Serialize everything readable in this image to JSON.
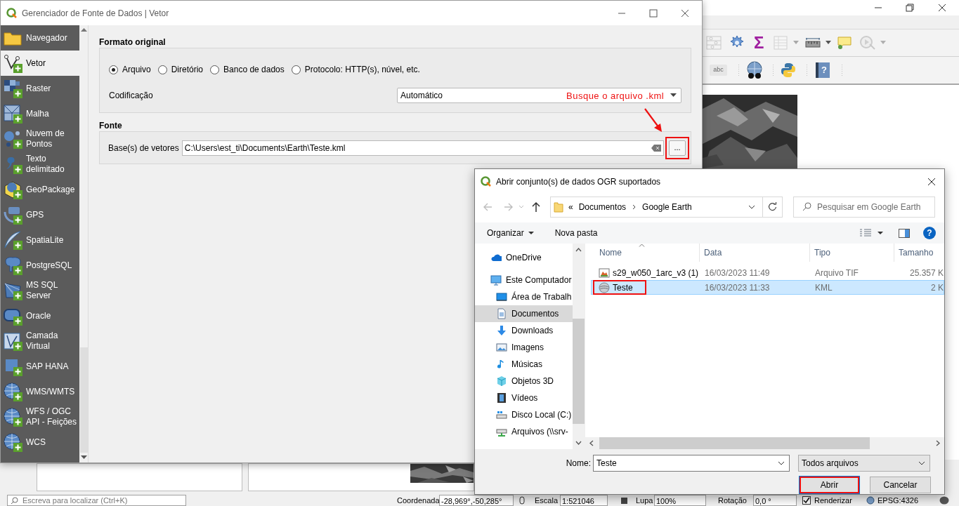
{
  "qgis": {
    "toolbar_glyphs": {
      "sum": "Σ",
      "label": "abc",
      "help": "?"
    },
    "status_bar": {
      "search_placeholder": "Escreva para localizar (Ctrl+K)",
      "coordinate_label": "Coordenada",
      "coordinate": "-28,969°,-50,285°",
      "scale_label": "Escala",
      "scale": "1:521046",
      "magnifier_label": "Lupa",
      "magnifier": "100%",
      "rotation_label": "Rotação",
      "rotation": "0,0 °",
      "render_label": "Renderizar",
      "render_checked": true,
      "crs": "EPSG:4326"
    }
  },
  "data_source_manager": {
    "title": "Gerenciador de Fonte de Dados | Vetor",
    "sidebar": [
      {
        "label": "Navegador",
        "selected": false
      },
      {
        "label": "Vetor",
        "selected": true
      },
      {
        "label": "Raster",
        "selected": false
      },
      {
        "label": "Malha",
        "selected": false
      },
      {
        "label": "Nuvem de Pontos",
        "selected": false
      },
      {
        "label": "Texto delimitado",
        "selected": false
      },
      {
        "label": "GeoPackage",
        "selected": false
      },
      {
        "label": "GPS",
        "selected": false
      },
      {
        "label": "SpatiaLite",
        "selected": false
      },
      {
        "label": "PostgreSQL",
        "selected": false
      },
      {
        "label": "MS SQL Server",
        "selected": false
      },
      {
        "label": "Oracle",
        "selected": false
      },
      {
        "label": "Camada Virtual",
        "selected": false
      },
      {
        "label": "SAP HANA",
        "selected": false
      },
      {
        "label": "WMS/WMTS",
        "selected": false
      },
      {
        "label": "WFS / OGC API - Feições",
        "selected": false
      },
      {
        "label": "WCS",
        "selected": false
      }
    ],
    "source_type": {
      "title": "Formato original",
      "options": [
        {
          "label": "Arquivo",
          "selected": true
        },
        {
          "label": "Diretório",
          "selected": false
        },
        {
          "label": "Banco de dados",
          "selected": false
        },
        {
          "label": "Protocolo: HTTP(s), núvel, etc.",
          "selected": false
        }
      ],
      "encoding_label": "Codificação",
      "encoding": "Automático"
    },
    "source": {
      "title": "Fonte",
      "dataset_label": "Base(s) de vetores",
      "dataset_path": "C:\\Users\\est_ti\\Documents\\Earth\\Teste.kml",
      "browse_button": "...",
      "browse_highlighted": true
    },
    "annotation": "Busque o arquivo .kml"
  },
  "file_dialog": {
    "title": "Abrir conjunto(s) de dados OGR suportados",
    "overflow_marker": "«",
    "breadcrumb": [
      "Documentos",
      "Google Earth"
    ],
    "search_placeholder": "Pesquisar em Google Earth",
    "toolbar": [
      "Organizar",
      "Nova pasta"
    ],
    "help_glyph": "?",
    "navigation": [
      {
        "label": "OneDrive",
        "selected": false
      },
      {
        "label": "Este Computador",
        "selected": false,
        "children": [
          {
            "label": "Área de Trabalh",
            "selected": false
          },
          {
            "label": "Documentos",
            "selected": true
          },
          {
            "label": "Downloads",
            "selected": false
          },
          {
            "label": "Imagens",
            "selected": false
          },
          {
            "label": "Músicas",
            "selected": false
          },
          {
            "label": "Objetos 3D",
            "selected": false
          },
          {
            "label": "Vídeos",
            "selected": false
          },
          {
            "label": "Disco Local (C:)",
            "selected": false
          },
          {
            "label": "Arquivos (\\\\srv-",
            "selected": false
          }
        ]
      }
    ],
    "columns": [
      "Nome",
      "Data",
      "Tipo",
      "Tamanho"
    ],
    "files": [
      {
        "kind": "raster",
        "name": "s29_w050_1arc_v3 (1)",
        "date": "16/03/2023 11:49",
        "type": "Arquivo TIF",
        "size": "25.357 K",
        "selected": false,
        "highlighted": false
      },
      {
        "kind": "kml",
        "name": "Teste",
        "date": "16/03/2023 11:33",
        "type": "KML",
        "size": "2 K",
        "selected": true,
        "highlighted": true
      }
    ],
    "file_name_label": "Nome:",
    "file_name": "Teste",
    "file_type": "Todos arquivos",
    "buttons": [
      {
        "label": "Abrir",
        "highlighted": true
      },
      {
        "label": "Cancelar",
        "highlighted": false
      }
    ]
  }
}
